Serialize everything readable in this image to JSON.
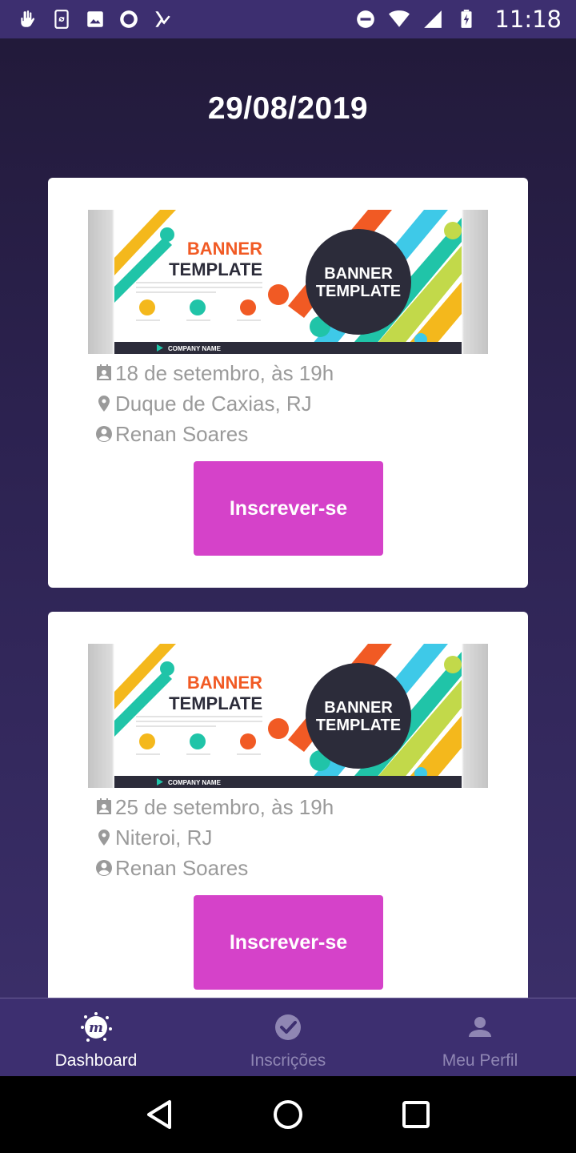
{
  "status_bar": {
    "time": "11:18",
    "left_icons": [
      "gesture-icon",
      "sync-phone-icon",
      "image-icon",
      "circle-record-icon",
      "check-flag-icon"
    ],
    "right_icons": [
      "do-not-disturb-icon",
      "wifi-icon",
      "signal-icon",
      "battery-charging-icon"
    ]
  },
  "header": {
    "date": "29/08/2019"
  },
  "events": [
    {
      "banner": {
        "heading_line1": "BANNER",
        "heading_line2": "TEMPLATE",
        "circle_line1": "BANNER",
        "circle_line2": "TEMPLATE",
        "footer": "COMPANY NAME"
      },
      "date_text": "18 de setembro, às 19h",
      "location": "Duque de Caxias, RJ",
      "organizer": "Renan Soares",
      "button_label": "Inscrever-se"
    },
    {
      "banner": {
        "heading_line1": "BANNER",
        "heading_line2": "TEMPLATE",
        "circle_line1": "BANNER",
        "circle_line2": "TEMPLATE",
        "footer": "COMPANY NAME"
      },
      "date_text": "25 de setembro, às 19h",
      "location": "Niteroi, RJ",
      "organizer": "Renan Soares",
      "button_label": "Inscrever-se"
    }
  ],
  "bottom_nav": {
    "items": [
      {
        "label": "Dashboard",
        "icon": "meetup-logo-icon",
        "active": true
      },
      {
        "label": "Inscrições",
        "icon": "check-circle-icon",
        "active": false
      },
      {
        "label": "Meu Perfil",
        "icon": "person-icon",
        "active": false
      }
    ]
  },
  "colors": {
    "primary": "#3d2f70",
    "accent_button": "#d542c9",
    "info_text": "#9a9a9a",
    "nav_inactive": "#8f86b3"
  }
}
